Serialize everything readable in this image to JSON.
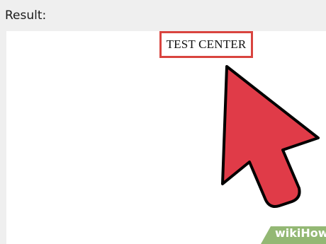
{
  "header": {
    "result_label": "Result:"
  },
  "preview": {
    "test_center_text": "TEST CENTER"
  },
  "cursor": {
    "icon": "mouse-pointer-icon",
    "color": "#e03b48",
    "outline_color": "#000000"
  },
  "watermark": {
    "brand_wiki": "wiki",
    "brand_how": "How",
    "color": "#93b874"
  },
  "colors": {
    "highlight_border": "#d9443f",
    "panel_background": "#ffffff",
    "page_background": "#efefef"
  }
}
